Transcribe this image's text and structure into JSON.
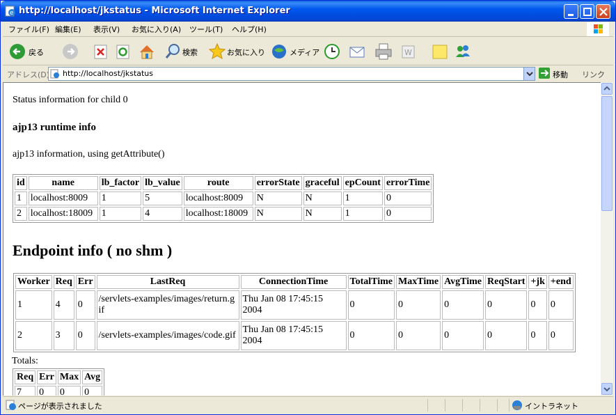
{
  "window": {
    "title": "http://localhost/jkstatus - Microsoft Internet Explorer"
  },
  "menu": [
    "ファイル(F)",
    "編集(E)",
    "表示(V)",
    "お気に入り(A)",
    "ツール(T)",
    "ヘルプ(H)"
  ],
  "toolbar": {
    "back": "戻る",
    "search": "検索",
    "favorites": "お気に入り",
    "media": "メディア"
  },
  "address": {
    "label": "アドレス(D)",
    "url": "http://localhost/jkstatus",
    "go": "移動",
    "links": "リンク"
  },
  "page": {
    "status_line": "Status information for child 0",
    "runtime_heading": "ajp13 runtime info",
    "runtime_desc": "ajp13 information, using getAttribute()",
    "runtime_table": {
      "headers": [
        "id",
        "name",
        "lb_factor",
        "lb_value",
        "route",
        "errorState",
        "graceful",
        "epCount",
        "errorTime"
      ],
      "rows": [
        [
          "1",
          "localhost:8009",
          "1",
          "5",
          "localhost:8009",
          "N",
          "N",
          "1",
          "0"
        ],
        [
          "2",
          "localhost:18009",
          "1",
          "4",
          "localhost:18009",
          "N",
          "N",
          "1",
          "0"
        ]
      ]
    },
    "endpoint_heading": "Endpoint info ( no shm )",
    "endpoint_table": {
      "headers": [
        "Worker",
        "Req",
        "Err",
        "LastReq",
        "ConnectionTime",
        "TotalTime",
        "MaxTime",
        "AvgTime",
        "ReqStart",
        "+jk",
        "+end"
      ],
      "rows": [
        [
          "1",
          "4",
          "0",
          "/servlets-examples/images/return.gif",
          "Thu Jan 08 17:45:15 2004",
          "0",
          "0",
          "0",
          "0",
          "0",
          "0"
        ],
        [
          "2",
          "3",
          "0",
          "/servlets-examples/images/code.gif",
          "Thu Jan 08 17:45:15 2004",
          "0",
          "0",
          "0",
          "0",
          "0",
          "0"
        ]
      ]
    },
    "totals_label": "Totals:",
    "totals_table": {
      "headers": [
        "Req",
        "Err",
        "Max",
        "Avg"
      ],
      "rows": [
        [
          "7",
          "0",
          "0",
          "0"
        ]
      ]
    }
  },
  "status": {
    "text": "ページが表示されました",
    "zone": "イントラネット"
  }
}
